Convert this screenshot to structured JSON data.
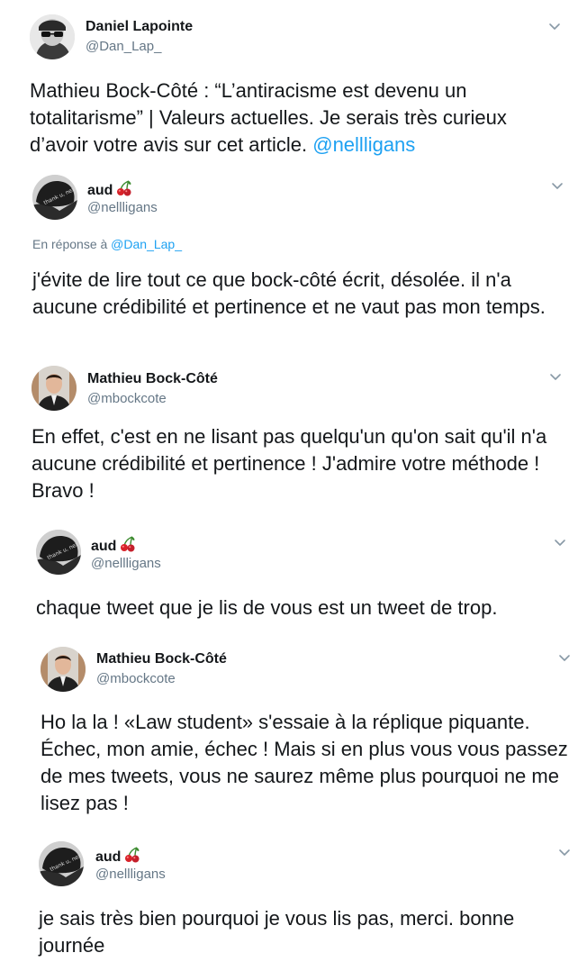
{
  "tweets": [
    {
      "name": "Daniel Lapointe",
      "handle": "@Dan_Lap_",
      "text": "Mathieu Bock-Côté : “L’antiracisme est devenu un totalitarisme” | Valeurs actuelles. Je serais très curieux d’avoir votre avis sur cet article. ",
      "mention": "@nellligans",
      "avatar": "sunglasses-avatar"
    },
    {
      "name": "aud",
      "emoji": "cherries-icon",
      "handle": "@nellligans",
      "reply_prefix": "En réponse à ",
      "reply_handle": "@Dan_Lap_",
      "text": "j'évite de lire tout ce que bock-côté écrit, désolée. il n'a aucune crédibilité et pertinence et ne vaut pas mon temps.",
      "avatar": "dark-hat-avatar"
    },
    {
      "name": "Mathieu Bock-Côté",
      "handle": "@mbockcote",
      "text": "En effet, c'est en ne lisant pas quelqu'un qu'on sait qu'il n'a aucune crédibilité et pertinence ! J'admire votre méthode ! Bravo !",
      "avatar": "suit-man-avatar"
    },
    {
      "name": "aud",
      "emoji": "cherries-icon",
      "handle": "@nellligans",
      "text": "chaque tweet que je lis de vous est un tweet de trop.",
      "avatar": "dark-hat-avatar"
    },
    {
      "name": "Mathieu Bock-Côté",
      "handle": "@mbockcote",
      "text": "Ho la la ! «Law student» s'essaie à la réplique piquante. Échec, mon amie, échec ! Mais si en plus vous vous passez de mes tweets, vous ne saurez même plus pourquoi ne me lisez pas !",
      "avatar": "suit-man-avatar"
    },
    {
      "name": "aud",
      "emoji": "cherries-icon",
      "handle": "@nellligans",
      "text": "je sais très bien pourquoi je vous lis pas, merci. bonne journée",
      "avatar": "dark-hat-avatar"
    }
  ],
  "colors": {
    "text": "#14171a",
    "secondary": "#657786",
    "link": "#1da1f2",
    "cherry": "#e0245e",
    "stem": "#3c8b2f"
  }
}
